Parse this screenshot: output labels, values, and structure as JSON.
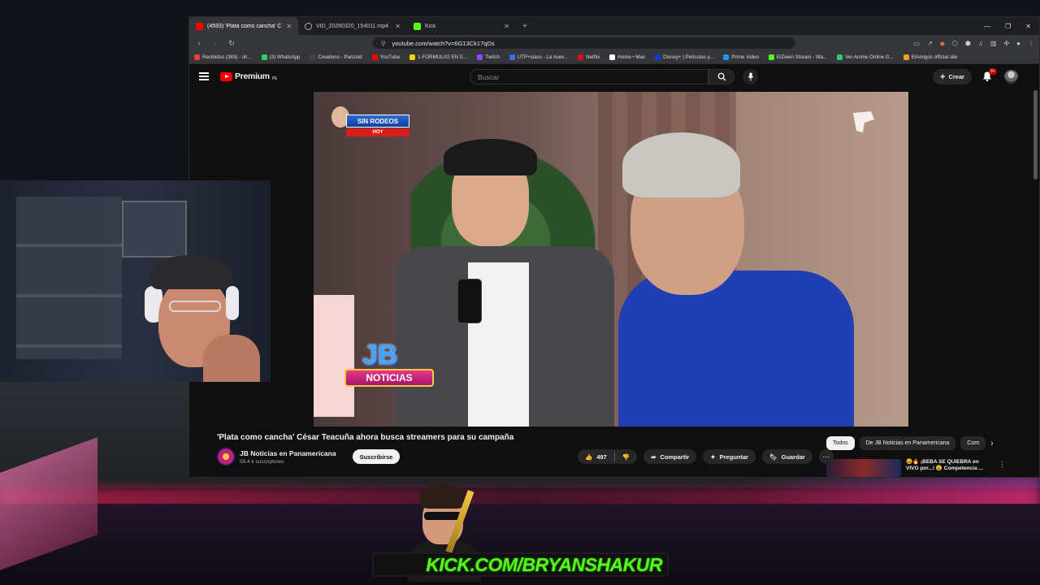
{
  "colors": {
    "youtube_red": "#ff0000",
    "kick_green": "#53fc18",
    "yt_background": "#0f0f0f",
    "chip_active": "#f1f1f1"
  },
  "browser": {
    "tabs": [
      {
        "label": "(4593) 'Plata como cancha' C",
        "icon": "youtube-icon",
        "active": true
      },
      {
        "label": "VID_20260320_154011.mp4",
        "icon": "globe-icon",
        "active": false
      },
      {
        "label": "Kick",
        "icon": "kick-icon",
        "active": false
      }
    ],
    "url": "youtube.com/watch?v=6G13Ck17qDs",
    "bookmarks": [
      {
        "label": "Recibidos (383) - sh...",
        "color": "#ea4335"
      },
      {
        "label": "(3) WhatsApp",
        "color": "#25d366"
      },
      {
        "label": "Creations - Panzoid",
        "color": "#444444"
      },
      {
        "label": "YouTube",
        "color": "#ff0000"
      },
      {
        "label": "1-FORMULAS EN E...",
        "color": "#ffd200"
      },
      {
        "label": "Twitch",
        "color": "#9146ff"
      },
      {
        "label": "UTP+class - La nuev...",
        "color": "#3b6ee5"
      },
      {
        "label": "Netflix",
        "color": "#e50914"
      },
      {
        "label": "Home • Max",
        "color": "#ffffff"
      },
      {
        "label": "Disney+ | Películas y...",
        "color": "#113ccf"
      },
      {
        "label": "Prime Video",
        "color": "#1a98ff"
      },
      {
        "label": "ElZeein Stream - Wa...",
        "color": "#53fc18"
      },
      {
        "label": "Ver Anime Online G...",
        "color": "#2ecc71"
      },
      {
        "label": "ElAmigos official site",
        "color": "#f0a030"
      }
    ]
  },
  "youtube": {
    "logo_text": "Premium",
    "region": "PE",
    "search_placeholder": "Buscar",
    "create_label": "Crear",
    "notifications_badge": "9+",
    "video": {
      "bug_text": "SIN RODEOS",
      "bug_sub": "HOY",
      "jb_text": "JB",
      "jb_ribbon": "NOTICIAS",
      "title": "'Plata como cancha' César Teacuña ahora busca streamers para su campaña",
      "channel_name": "JB Noticias en Panamericana",
      "subscribers": "59.4 k suscriptores",
      "subscribe_label": "Suscribirse",
      "likes": "497",
      "share_label": "Compartir",
      "ask_label": "Preguntar",
      "save_label": "Guardar"
    },
    "chips": [
      {
        "label": "Todos",
        "active": true
      },
      {
        "label": "De JB Noticias en Panamericana",
        "active": false
      },
      {
        "label": "Com",
        "active": false
      }
    ],
    "recommended": {
      "title_line1": "😆🔥 ¡BEBA SE QUIEBRA en",
      "title_line2": "VIVO por...! 😮 Competencia ..."
    }
  },
  "overlay": {
    "kick_url": "KICK.COM/BRYANSHAKUR"
  }
}
